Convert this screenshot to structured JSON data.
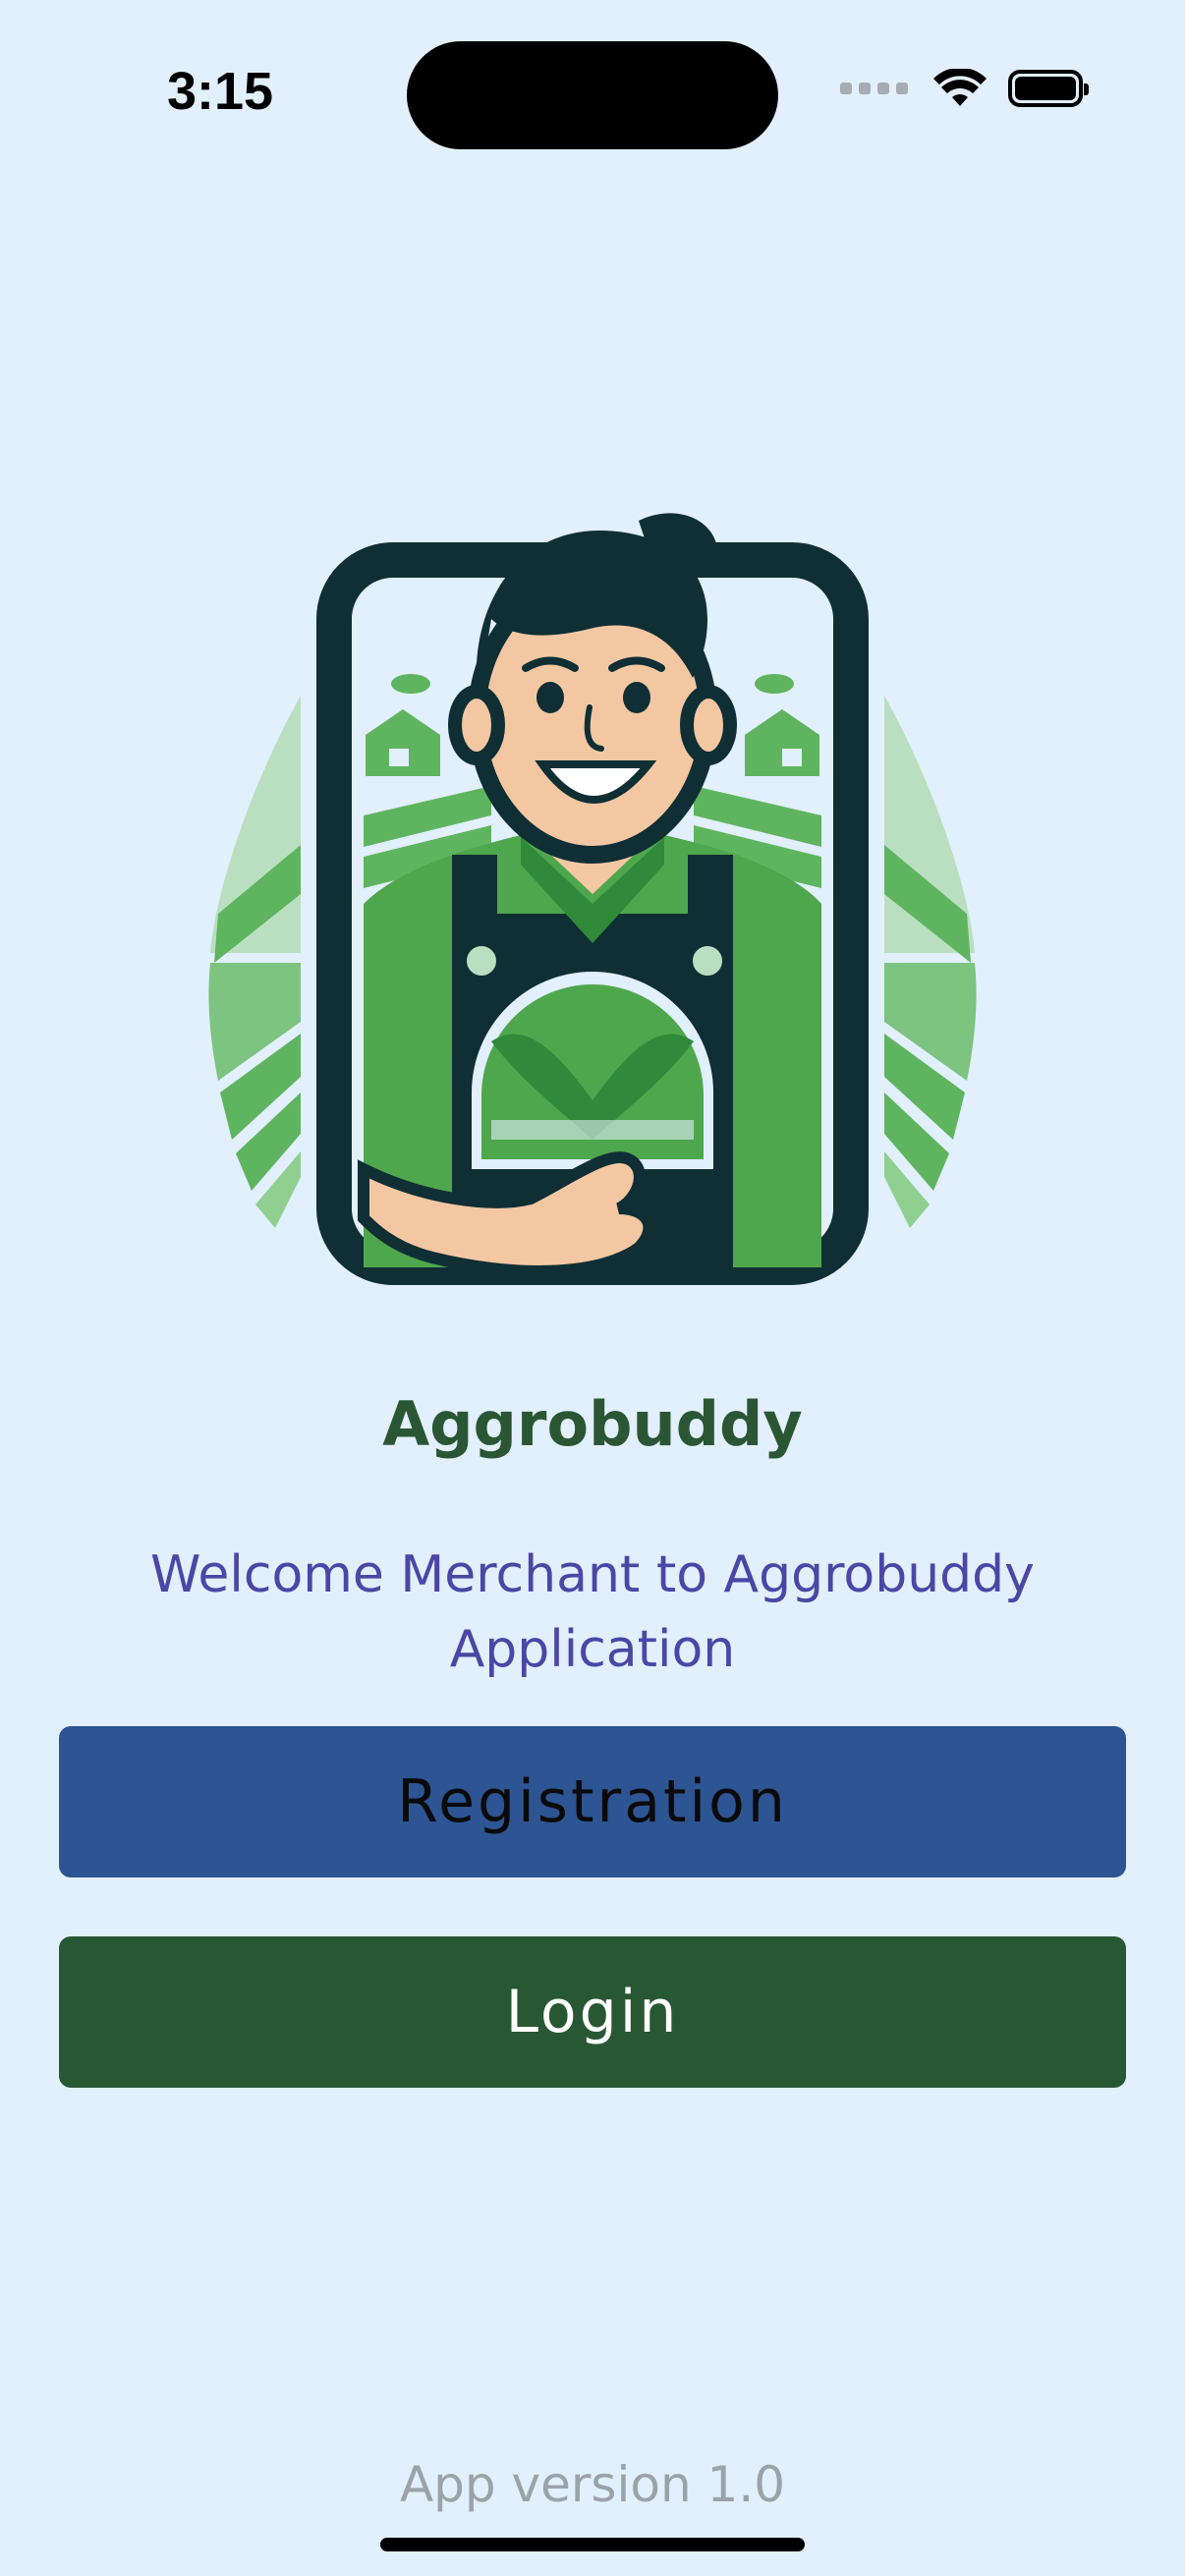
{
  "status_bar": {
    "time": "3:15"
  },
  "app": {
    "title": "Aggrobuddy",
    "welcome_text": "Welcome Merchant to Aggrobuddy Application",
    "registration_label": "Registration",
    "login_label": "Login",
    "version_text": "App version 1.0"
  },
  "colors": {
    "background": "#e2effc",
    "title": "#2a5634",
    "welcome": "#4a47a6",
    "registration_button": "#2d5493",
    "login_button": "#285733",
    "version": "#9aa3a8"
  },
  "icons": {
    "logo": "farmer-logo-icon",
    "wifi": "wifi-icon",
    "battery": "battery-icon",
    "signal": "signal-icon"
  }
}
